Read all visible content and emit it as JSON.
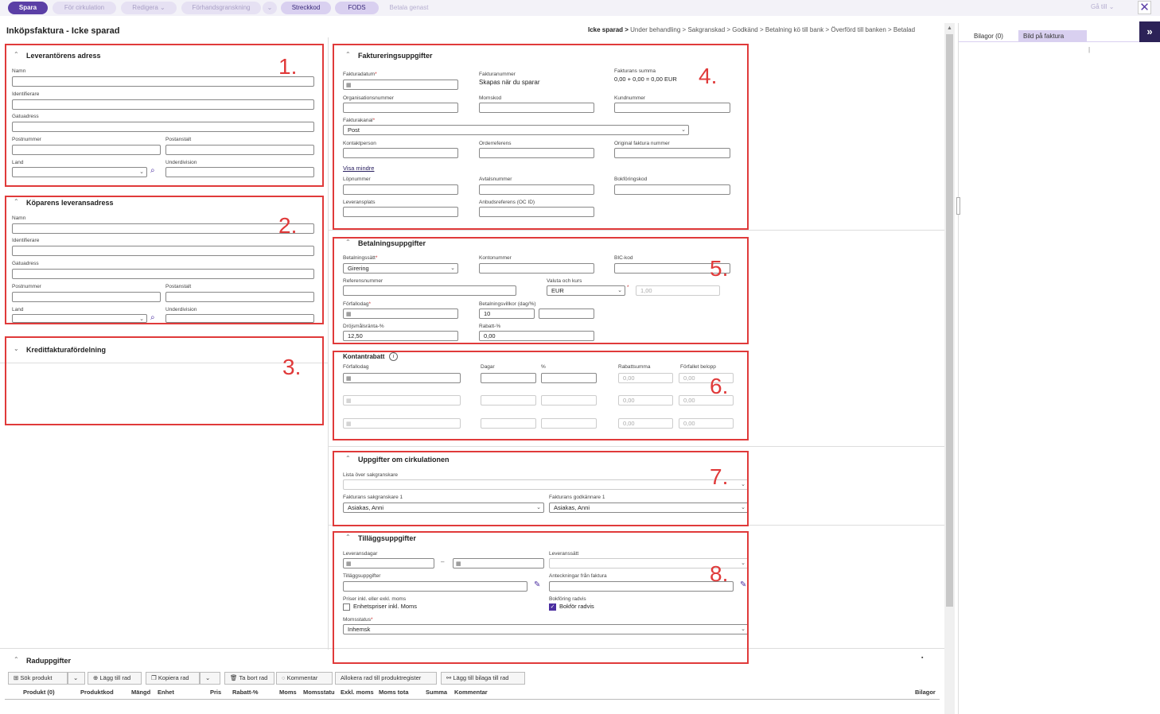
{
  "toolbar": {
    "save": "Spara",
    "for_circulation": "För cirkulation",
    "edit": "Redigera",
    "preview": "Förhandsgranskning",
    "barcode": "Streckkod",
    "fods": "FODS",
    "pay_now": "Betala genast",
    "goto": "Gå till",
    "close": "✕"
  },
  "header": {
    "title": "Inköpsfaktura - Icke sparad",
    "breadcrumb": [
      "Icke sparad >",
      "Under behandling >",
      "Sakgranskad >",
      "Godkänd >",
      "Betalning kö till bank >",
      "Överförd till banken >",
      "Betalad"
    ]
  },
  "right_panel": {
    "tab_attachments": "Bilagor (0)",
    "tab_invoice_image": "Bild på faktura",
    "expand": "»"
  },
  "annotations": [
    "1.",
    "2.",
    "3.",
    "4.",
    "5.",
    "6.",
    "7.",
    "8."
  ],
  "supplier": {
    "title": "Leverantörens adress",
    "name": "Namn",
    "identifier": "Identifierare",
    "street": "Gatuadress",
    "postal": "Postnummer",
    "city": "Postanstalt",
    "country": "Land",
    "subdivision": "Underdivision"
  },
  "buyer": {
    "title": "Köparens leveransadress",
    "name": "Namn",
    "identifier": "Identifierare",
    "street": "Gatuadress",
    "postal": "Postnummer",
    "city": "Postanstalt",
    "country": "Land",
    "subdivision": "Underdivision"
  },
  "credit": {
    "title": "Kreditfakturafördelning"
  },
  "invoice": {
    "title": "Faktureringsuppgifter",
    "date": "Fakturadatum",
    "number": "Fakturanummer",
    "number_value": "Skapas när du sparar",
    "sum": "Fakturans summa",
    "sum_value": "0,00 + 0,00 = 0,00 EUR",
    "org_number": "Organisationsnummer",
    "vat_code": "Momskod",
    "customer_number": "Kundnummer",
    "channel": "Fakturakanal",
    "channel_value": "Post",
    "contact": "Kontaktperson",
    "order_ref": "Orderreferens",
    "original_number": "Original faktura nummer",
    "show_less": "Visa mindre",
    "serial": "Löpnummer",
    "contract": "Avtalsnummer",
    "booking_code": "Bokföringskod",
    "delivery_place": "Leveransplats",
    "tender_ref": "Anbudsreferens (OC ID)"
  },
  "payment": {
    "title": "Betalningsuppgifter",
    "method": "Betalningssätt",
    "method_value": "Girering",
    "account": "Kontonummer",
    "bic": "BIC-kod",
    "reference": "Referensnummer",
    "currency": "Valuta och kurs",
    "currency_value": "EUR",
    "rate_value": "1,00",
    "due": "Förfallodag",
    "terms": "Betalningsvillkor (dag/%)",
    "terms_value": "10",
    "interest": "Dröjsmålsränta-%",
    "interest_value": "12,50",
    "discount": "Rabatt-%",
    "discount_value": "0,00"
  },
  "cash_discount": {
    "title": "Kontantrabatt",
    "due": "Förfallodag",
    "days": "Dagar",
    "pct": "%",
    "amount": "Rabattsumma",
    "due_amount": "Förfallet belopp",
    "rows": [
      {
        "amount": "0,00",
        "due_amount": "0,00"
      },
      {
        "amount": "0,00",
        "due_amount": "0,00"
      },
      {
        "amount": "0,00",
        "due_amount": "0,00"
      }
    ]
  },
  "circulation": {
    "title": "Uppgifter om cirkulationen",
    "reviewers_list": "Lista över sakgranskare",
    "reviewer": "Fakturans sakgranskare 1",
    "reviewer_value": "Asiakas, Anni",
    "approver": "Fakturans godkännare 1",
    "approver_value": "Asiakas, Anni"
  },
  "additional": {
    "title": "Tilläggsuppgifter",
    "delivery_days": "Leveransdagar",
    "dash": "–",
    "delivery_method": "Leveranssätt",
    "additional_info": "Tilläggsuppgifter",
    "notes": "Anteckningar från faktura",
    "prices_label": "Priser inkl. eller exkl. moms",
    "prices_check": "Enhetspriser inkl. Moms",
    "booking_label": "Bokföring radvis",
    "booking_check": "Bokför radvis",
    "vat_status": "Momsstatus",
    "vat_status_value": "Inhemsk"
  },
  "rows": {
    "title": "Raduppgifter",
    "buttons": [
      "Sök produkt",
      "Lägg till rad",
      "Kopiera rad",
      "Ta bort rad",
      "Kommentar",
      "Allokera rad till produktregister",
      "Lägg till bilaga till rad"
    ],
    "columns": [
      "Produkt (0)",
      "Produktkod",
      "Mängd",
      "Enhet",
      "Pris",
      "Rabatt-%",
      "Moms",
      "Momsstatu",
      "Exkl. moms",
      "Moms tota",
      "Summa",
      "Kommentar",
      "Bilagor"
    ]
  }
}
